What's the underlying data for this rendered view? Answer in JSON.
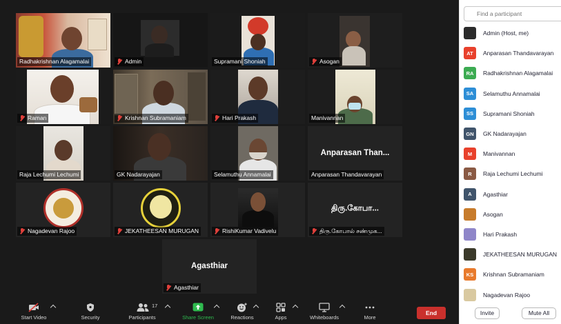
{
  "gallery": {
    "tiles": [
      {
        "name": "Radhakrishnan Alagamalai",
        "muted": false
      },
      {
        "name": "Admin",
        "muted": true
      },
      {
        "name": "Supramani Shoniah",
        "muted": false
      },
      {
        "name": "Asogan",
        "muted": true
      },
      {
        "name": "Raman",
        "muted": true
      },
      {
        "name": "Krishnan Subramaniam",
        "muted": true
      },
      {
        "name": "Hari Prakash",
        "muted": true
      },
      {
        "name": "Manivannan",
        "muted": false
      },
      {
        "name": "Raja Lechumi Lechumi",
        "muted": false
      },
      {
        "name": "GK Nadarayajan",
        "muted": false
      },
      {
        "name": "Selamuthu Annamalai",
        "muted": false
      },
      {
        "name": "Anparasan Thandavarayan",
        "muted": false,
        "display": "Anparasan  Than..."
      },
      {
        "name": "Nagadevan Rajoo",
        "muted": true
      },
      {
        "name": "JEKATHEESAN MURUGAN",
        "muted": true
      },
      {
        "name": "RishiKumar Vadivelu",
        "muted": true
      },
      {
        "name": "திரு.கோபால் சண்முக...",
        "muted": true,
        "display": "திரு.கோபா..."
      },
      {
        "name": "Agasthiar",
        "muted": true,
        "display": "Agasthiar"
      }
    ]
  },
  "toolbar": {
    "start_video": "Start Video",
    "security": "Security",
    "participants": "Participants",
    "participant_count": "17",
    "share_screen": "Share Screen",
    "reactions": "Reactions",
    "apps": "Apps",
    "whiteboards": "Whiteboards",
    "more": "More",
    "end": "End"
  },
  "panel": {
    "search_placeholder": "Find a participant",
    "participants": [
      {
        "name": "Admin (Host, me)",
        "initials": "",
        "color": "#2b2b2b"
      },
      {
        "name": "Anparasan Thandavarayan",
        "initials": "AT",
        "color": "#e8412c"
      },
      {
        "name": "Radhakrishnan Alagamalai",
        "initials": "RA",
        "color": "#3cab52"
      },
      {
        "name": "Selamuthu Annamalai",
        "initials": "SA",
        "color": "#2d8ed6"
      },
      {
        "name": "Supramani Shoniah",
        "initials": "SS",
        "color": "#2d8ed6"
      },
      {
        "name": "GK Nadarayajan",
        "initials": "GN",
        "color": "#40546b"
      },
      {
        "name": "Manivannan",
        "initials": "M",
        "color": "#e8412c"
      },
      {
        "name": "Raja Lechumi Lechumi",
        "initials": "R",
        "color": "#8a5a44"
      },
      {
        "name": "Agasthiar",
        "initials": "A",
        "color": "#40546b"
      },
      {
        "name": "Asogan",
        "initials": "",
        "color": "#c77b2b"
      },
      {
        "name": "Hari Prakash",
        "initials": "",
        "color": "#8f86c9"
      },
      {
        "name": "JEKATHEESAN MURUGAN",
        "initials": "",
        "color": "#3b3a2a"
      },
      {
        "name": "Krishnan Subramaniam",
        "initials": "KS",
        "color": "#e87a2c"
      },
      {
        "name": "Nagadevan Rajoo",
        "initials": "",
        "color": "#d9c9a0"
      }
    ],
    "invite": "Invite",
    "mute_all": "Mute All"
  },
  "colors": {
    "active_speaker": "#b8d43c",
    "end_button": "#c9302c",
    "share_screen": "#2fbb4f"
  }
}
